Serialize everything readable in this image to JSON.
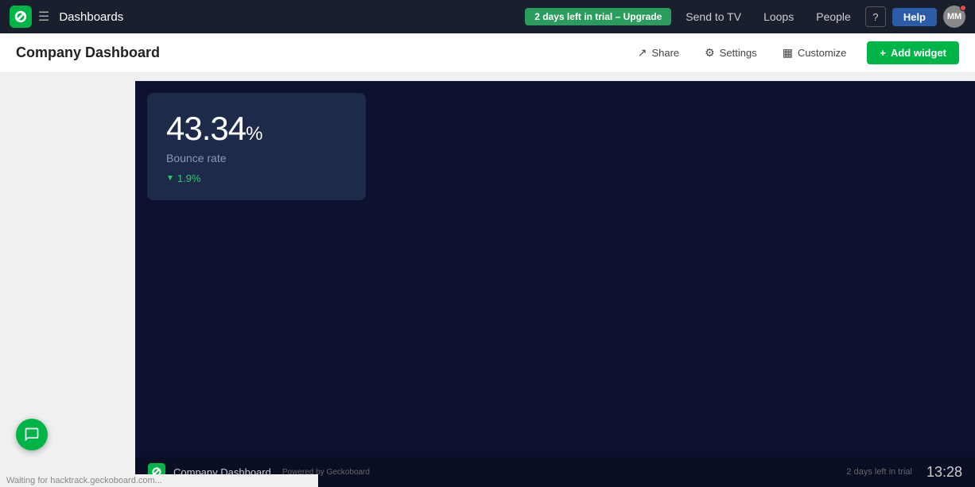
{
  "nav": {
    "logo_label": "G",
    "menu_icon": "☰",
    "title": "Dashboards",
    "trial_badge": "2 days left in trial – Upgrade",
    "send_to_tv": "Send to TV",
    "loops": "Loops",
    "people": "People",
    "help_icon": "?",
    "help_btn": "Help",
    "avatar": "MM",
    "avatar_color": "#888"
  },
  "sub_header": {
    "title": "Company Dashboard",
    "share_label": "Share",
    "settings_label": "Settings",
    "customize_label": "Customize",
    "add_widget_label": "Add widget"
  },
  "widget": {
    "value": "43.34",
    "unit": "%",
    "label": "Bounce rate",
    "change_value": "1.9%",
    "change_direction": "down"
  },
  "dashboard_footer": {
    "dashboard_name": "Company Dashboard",
    "powered_by": "Powered by Geckoboard",
    "trial_text": "2 days left in trial",
    "time": "13:28"
  },
  "status_bar": {
    "text": "Waiting for hacktrack.geckoboard.com..."
  },
  "colors": {
    "nav_bg": "#1a1f2e",
    "green": "#00b548",
    "dashboard_bg": "#0d1130",
    "widget_bg": "#1e2a4a"
  }
}
